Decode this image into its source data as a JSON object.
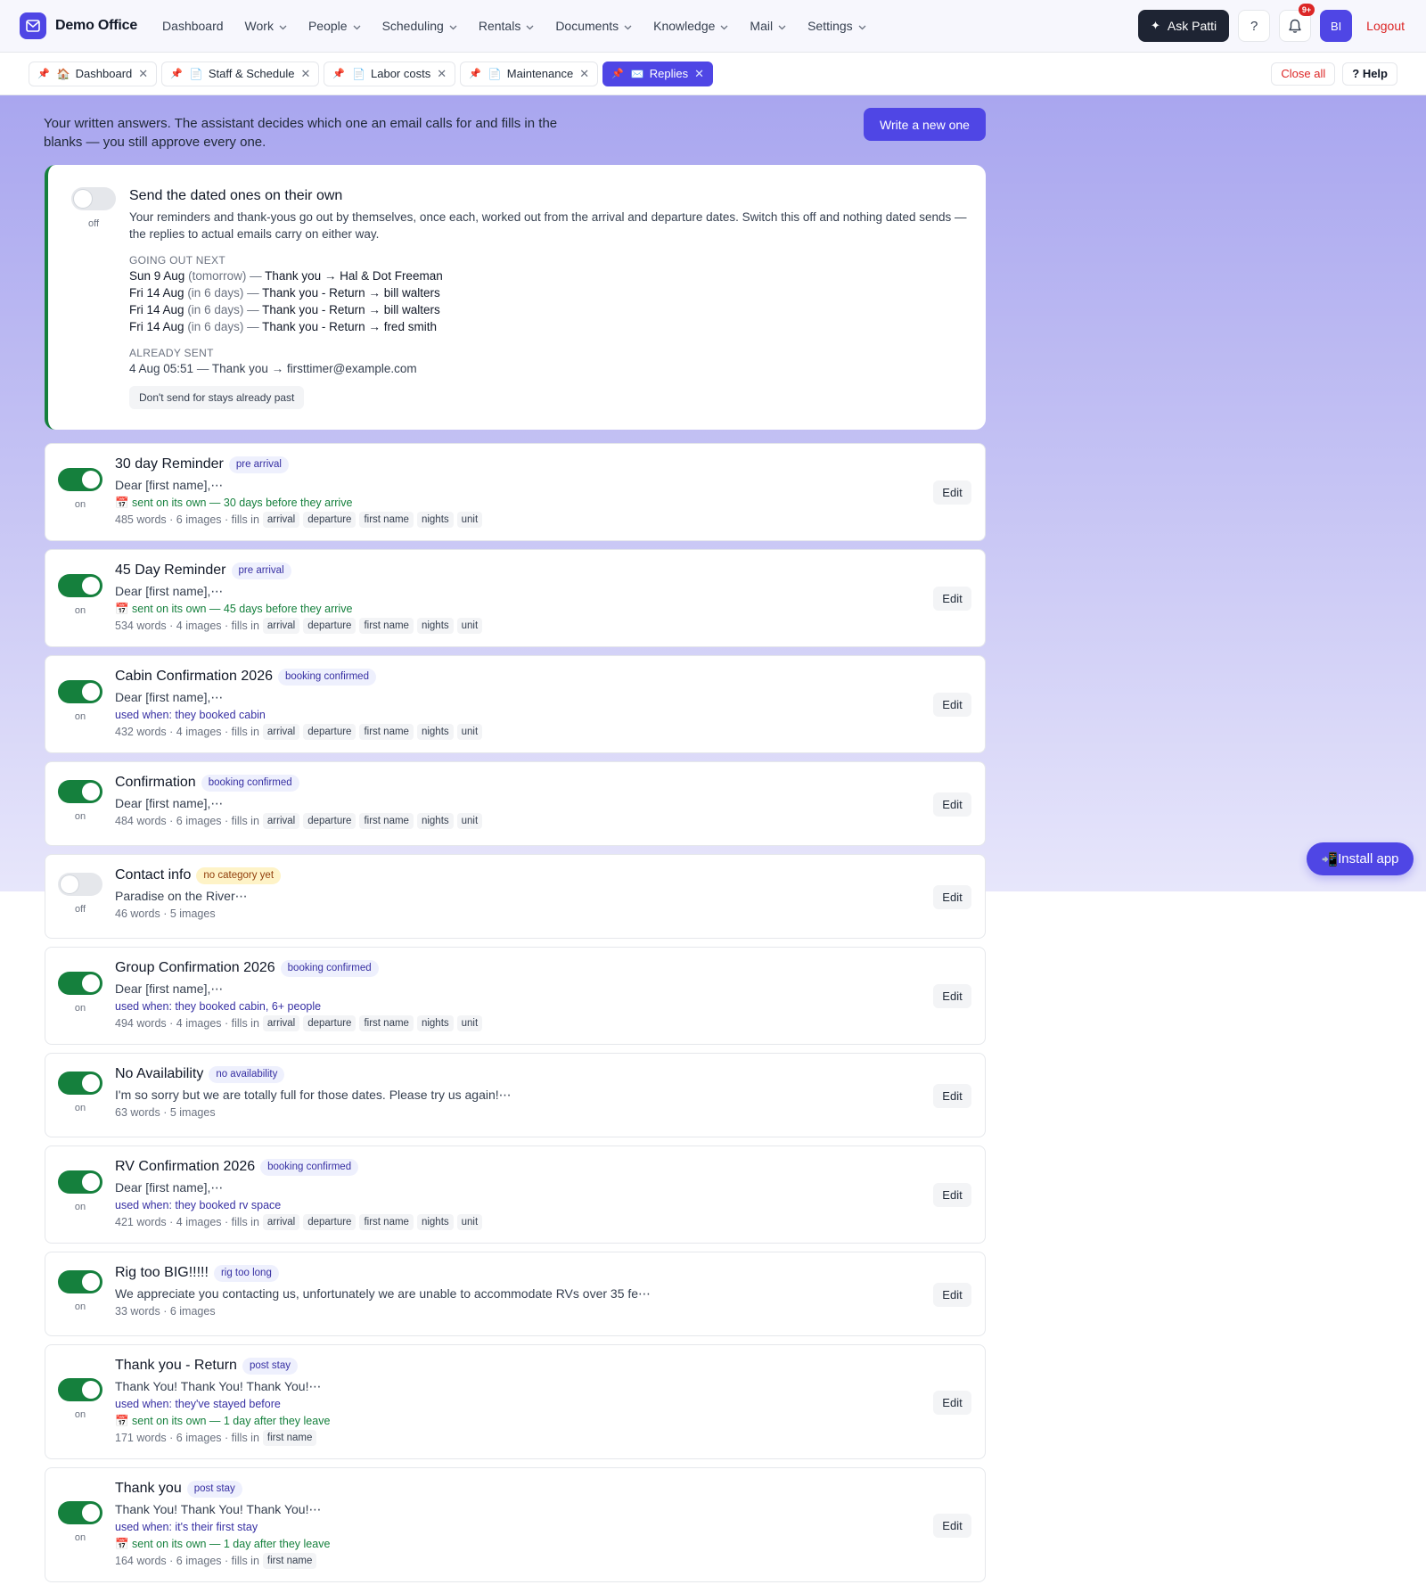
{
  "app": {
    "name": "Demo Office",
    "brand_color": "#4f46e5"
  },
  "nav": [
    {
      "label": "Dashboard",
      "has_menu": false
    },
    {
      "label": "Work",
      "has_menu": true
    },
    {
      "label": "People",
      "has_menu": true
    },
    {
      "label": "Scheduling",
      "has_menu": true
    },
    {
      "label": "Rentals",
      "has_menu": true
    },
    {
      "label": "Documents",
      "has_menu": true
    },
    {
      "label": "Knowledge",
      "has_menu": true
    },
    {
      "label": "Mail",
      "has_menu": true
    },
    {
      "label": "Settings",
      "has_menu": true
    }
  ],
  "header": {
    "ask_label": "Ask Patti",
    "help_icon_text": "?",
    "notifications_badge": "9+",
    "avatar_initials": "BI",
    "logout_label": "Logout"
  },
  "tabs": [
    {
      "label": "Dashboard",
      "icon": "🏠",
      "active": false
    },
    {
      "label": "Staff & Schedule",
      "icon": "📄",
      "active": false
    },
    {
      "label": "Labor costs",
      "icon": "📄",
      "active": false
    },
    {
      "label": "Maintenance",
      "icon": "📄",
      "active": false
    },
    {
      "label": "Replies",
      "icon": "✉️",
      "active": true
    }
  ],
  "tab_actions": {
    "close_all": "Close all",
    "help": "? Help"
  },
  "page": {
    "intro": "Your written answers. The assistant decides which one an email calls for and fills in the blanks — you still approve every one.",
    "new_button": "Write a new one"
  },
  "autosend": {
    "enabled": false,
    "state_label": "off",
    "title": "Send the dated ones on their own",
    "description": "Your reminders and thank-yous go out by themselves, once each, worked out from the arrival and departure dates. Switch this off and nothing dated sends — the replies to actual emails carry on either way.",
    "next_heading": "GOING OUT NEXT",
    "next": [
      {
        "date": "Sun 9 Aug",
        "rel": "(tomorrow)",
        "reply": "Thank you",
        "to": "Hal & Dot Freeman"
      },
      {
        "date": "Fri 14 Aug",
        "rel": "(in 6 days)",
        "reply": "Thank you - Return",
        "to": "bill walters"
      },
      {
        "date": "Fri 14 Aug",
        "rel": "(in 6 days)",
        "reply": "Thank you - Return",
        "to": "bill walters"
      },
      {
        "date": "Fri 14 Aug",
        "rel": "(in 6 days)",
        "reply": "Thank you - Return",
        "to": "fred smith"
      }
    ],
    "sent_heading": "ALREADY SENT",
    "sent": [
      {
        "date": "4 Aug 05:51",
        "reply": "Thank you",
        "to": "firsttimer@example.com"
      }
    ],
    "skip_button": "Don't send for stays already past"
  },
  "labels": {
    "edit": "Edit",
    "fills_in": "fills in",
    "auto_prefix": "sent on its own — "
  },
  "templates": [
    {
      "name": "30 day Reminder",
      "category": "pre arrival",
      "category_style": "blue",
      "enabled": true,
      "state": "on",
      "preview": "Dear [first name],⋯",
      "used_when": "",
      "auto": "30 days before they arrive",
      "words": "485 words",
      "images": "6 images",
      "fields": [
        "arrival",
        "departure",
        "first name",
        "nights",
        "unit"
      ]
    },
    {
      "name": "45 Day Reminder",
      "category": "pre arrival",
      "category_style": "blue",
      "enabled": true,
      "state": "on",
      "preview": "Dear [first name],⋯",
      "used_when": "",
      "auto": "45 days before they arrive",
      "words": "534 words",
      "images": "4 images",
      "fields": [
        "arrival",
        "departure",
        "first name",
        "nights",
        "unit"
      ]
    },
    {
      "name": "Cabin Confirmation 2026",
      "category": "booking confirmed",
      "category_style": "blue",
      "enabled": true,
      "state": "on",
      "preview": "Dear [first name],⋯",
      "used_when": "used when: they booked cabin",
      "auto": "",
      "words": "432 words",
      "images": "4 images",
      "fields": [
        "arrival",
        "departure",
        "first name",
        "nights",
        "unit"
      ]
    },
    {
      "name": "Confirmation",
      "category": "booking confirmed",
      "category_style": "blue",
      "enabled": true,
      "state": "on",
      "preview": "Dear [first name],⋯",
      "used_when": "",
      "auto": "",
      "words": "484 words",
      "images": "6 images",
      "fields": [
        "arrival",
        "departure",
        "first name",
        "nights",
        "unit"
      ]
    },
    {
      "name": "Contact info",
      "category": "no category yet",
      "category_style": "amber",
      "enabled": false,
      "state": "off",
      "preview": "Paradise on the River⋯",
      "used_when": "",
      "auto": "",
      "words": "46 words",
      "images": "5 images",
      "fields": []
    },
    {
      "name": "Group Confirmation 2026",
      "category": "booking confirmed",
      "category_style": "blue",
      "enabled": true,
      "state": "on",
      "preview": "Dear [first name],⋯",
      "used_when": "used when: they booked cabin, 6+ people",
      "auto": "",
      "words": "494 words",
      "images": "4 images",
      "fields": [
        "arrival",
        "departure",
        "first name",
        "nights",
        "unit"
      ]
    },
    {
      "name": "No Availability",
      "category": "no availability",
      "category_style": "blue",
      "enabled": true,
      "state": "on",
      "preview": "I'm so sorry but we are totally full for those dates.  Please try us again!⋯",
      "used_when": "",
      "auto": "",
      "words": "63 words",
      "images": "5 images",
      "fields": []
    },
    {
      "name": "RV Confirmation 2026",
      "category": "booking confirmed",
      "category_style": "blue",
      "enabled": true,
      "state": "on",
      "preview": "Dear [first name],⋯",
      "used_when": "used when: they booked rv space",
      "auto": "",
      "words": "421 words",
      "images": "4 images",
      "fields": [
        "arrival",
        "departure",
        "first name",
        "nights",
        "unit"
      ]
    },
    {
      "name": "Rig too BIG!!!!!",
      "category": "rig too long",
      "category_style": "blue",
      "enabled": true,
      "state": "on",
      "preview": "We appreciate you contacting us, unfortunately we are unable to accommodate RVs over 35 fe⋯",
      "used_when": "",
      "auto": "",
      "words": "33 words",
      "images": "6 images",
      "fields": []
    },
    {
      "name": "Thank you - Return",
      "category": "post stay",
      "category_style": "blue",
      "enabled": true,
      "state": "on",
      "preview": "Thank You! Thank You! Thank You!⋯",
      "used_when": "used when: they've stayed before",
      "auto": "1 day after they leave",
      "words": "171 words",
      "images": "6 images",
      "fields": [
        "first name"
      ]
    },
    {
      "name": "Thank you",
      "category": "post stay",
      "category_style": "blue",
      "enabled": true,
      "state": "on",
      "preview": "Thank You!     Thank You!     Thank You!⋯",
      "used_when": "used when: it's their first stay",
      "auto": "1 day after they leave",
      "words": "164 words",
      "images": "6 images",
      "fields": [
        "first name"
      ]
    }
  ],
  "install": {
    "label": "Install app",
    "icon": "📲"
  }
}
